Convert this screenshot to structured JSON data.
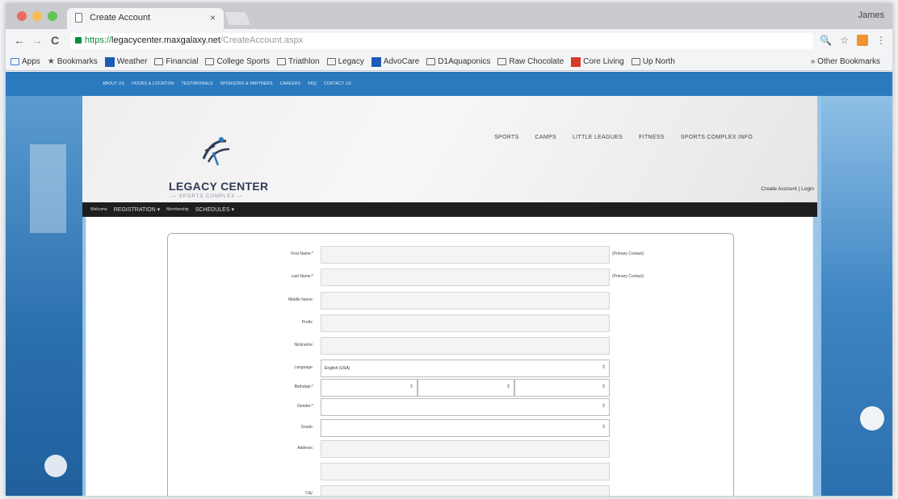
{
  "browser": {
    "tab_title": "Create Account",
    "tab_close": "×",
    "profile_name": "James",
    "url_proto": "https://",
    "url_host": "legacycenter.maxgalaxy.net",
    "url_path": "/CreateAccount.aspx",
    "nav": {
      "back": "←",
      "forward": "→",
      "reload": "C"
    },
    "toolbar_icons": {
      "zoom": "🔍",
      "star": "☆",
      "menu": "⋮"
    },
    "bookmarks": [
      {
        "label": "Apps",
        "icon": "apps-icon"
      },
      {
        "label": "Bookmarks",
        "icon": "star-icon"
      },
      {
        "label": "Weather",
        "icon": "weather-icon"
      },
      {
        "label": "Financial",
        "icon": "folder-icon"
      },
      {
        "label": "College Sports",
        "icon": "folder-icon"
      },
      {
        "label": "Triathlon",
        "icon": "folder-icon"
      },
      {
        "label": "Legacy",
        "icon": "folder-icon"
      },
      {
        "label": "AdvoCare",
        "icon": "advocare-icon"
      },
      {
        "label": "D1Aquaponics",
        "icon": "folder-icon"
      },
      {
        "label": "Raw Chocolate",
        "icon": "folder-icon"
      },
      {
        "label": "Core Living",
        "icon": "core-living-icon"
      },
      {
        "label": "Up North",
        "icon": "folder-icon"
      }
    ],
    "other_bookmarks": "» Other Bookmarks"
  },
  "site": {
    "top_nav": [
      "ABOUT US",
      "HOURS & LOCATION",
      "TESTIMONIALS",
      "SPONSORS & PARTNERS",
      "CAREERS",
      "FAQ",
      "CONTACT US"
    ],
    "logo_title": "LEGACY CENTER",
    "logo_subtitle": "— SPORTS COMPLEX —",
    "main_nav": [
      "SPORTS",
      "CAMPS",
      "LITTLE LEAGUES",
      "FITNESS",
      "SPORTS COMPLEX INFO"
    ],
    "account_links": "Create Account | Login",
    "sub_nav": {
      "welcome": "Welcome",
      "registration": "REGISTRATION ▾",
      "membership": "Membership",
      "schedules": "SCHEDULES ▾"
    }
  },
  "form": {
    "first_name_label": "First Name:*",
    "first_name_note": "(Primary Contact)",
    "last_name_label": "Last Name:*",
    "last_name_note": "(Primary Contact)",
    "middle_name_label": "Middle Name:",
    "prefix_label": "Prefix:",
    "nickname_label": "Nickname:",
    "language_label": "Language:",
    "language_value": "English (USA)",
    "birthdate_label": "Birthdate:*",
    "gender_label": "Gender:*",
    "grade_label": "Grade:",
    "address_label": "Address:",
    "city_label": "City:",
    "chevron": "⇕"
  }
}
